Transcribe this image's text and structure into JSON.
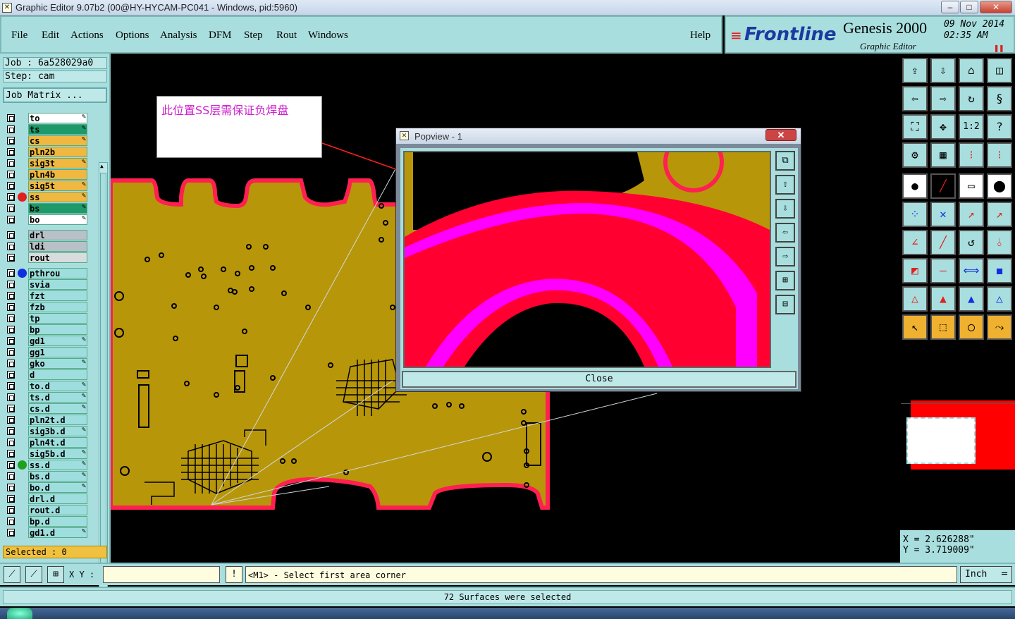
{
  "window": {
    "title": "Graphic Editor 9.07b2 (00@HY-HYCAM-PC041 - Windows, pid:5960)"
  },
  "menu": [
    "File",
    "Edit",
    "Actions",
    "Options",
    "Analysis",
    "DFM",
    "Step",
    "Rout",
    "Windows"
  ],
  "help": "Help",
  "logo": {
    "brand": "Frontline",
    "product": "Genesis 2000",
    "subtitle": "Graphic Editor",
    "date": "09 Nov 2014",
    "time": "02:35 AM"
  },
  "job": {
    "job": "Job : 6a528029a0",
    "step": "Step: cam",
    "matrix": "Job Matrix ..."
  },
  "layers": [
    {
      "name": "to",
      "color": "#ffffff",
      "edit": true
    },
    {
      "name": "ts",
      "color": "#1e9a6a",
      "edit": true
    },
    {
      "name": "cs",
      "color": "#f0b840",
      "edit": true
    },
    {
      "name": "pln2b",
      "color": "#f0b840",
      "edit": false
    },
    {
      "name": "sig3t",
      "color": "#f0b840",
      "edit": true
    },
    {
      "name": "pln4b",
      "color": "#f0b840",
      "edit": false
    },
    {
      "name": "sig5t",
      "color": "#f0b840",
      "edit": true
    },
    {
      "name": "ss",
      "color": "#f0b840",
      "edit": true,
      "dot": "#e02020"
    },
    {
      "name": "bs",
      "color": "#1e9a6a",
      "edit": true
    },
    {
      "name": "bo",
      "color": "#ffffff",
      "edit": true
    },
    {
      "name": "drl",
      "color": "#b8c0c8",
      "edit": false
    },
    {
      "name": "ldi",
      "color": "#b8c0c8",
      "edit": false
    },
    {
      "name": "rout",
      "color": "#d8dcdc",
      "edit": false
    },
    {
      "name": "pthrou",
      "color": "#9fdede",
      "edit": false,
      "dot": "#1030e0"
    },
    {
      "name": "svia",
      "color": "#9fdede",
      "edit": false
    },
    {
      "name": "fzt",
      "color": "#9fdede",
      "edit": false
    },
    {
      "name": "fzb",
      "color": "#9fdede",
      "edit": false
    },
    {
      "name": "tp",
      "color": "#9fdede",
      "edit": false
    },
    {
      "name": "bp",
      "color": "#9fdede",
      "edit": false
    },
    {
      "name": "gd1",
      "color": "#9fdede",
      "edit": true
    },
    {
      "name": "gg1",
      "color": "#9fdede",
      "edit": false
    },
    {
      "name": "gko",
      "color": "#9fdede",
      "edit": true
    },
    {
      "name": "d",
      "color": "#9fdede",
      "edit": false
    },
    {
      "name": "to.d",
      "color": "#9fdede",
      "edit": true
    },
    {
      "name": "ts.d",
      "color": "#9fdede",
      "edit": true
    },
    {
      "name": "cs.d",
      "color": "#9fdede",
      "edit": true
    },
    {
      "name": "pln2t.d",
      "color": "#9fdede",
      "edit": false
    },
    {
      "name": "sig3b.d",
      "color": "#9fdede",
      "edit": true
    },
    {
      "name": "pln4t.d",
      "color": "#9fdede",
      "edit": false
    },
    {
      "name": "sig5b.d",
      "color": "#9fdede",
      "edit": true
    },
    {
      "name": "ss.d",
      "color": "#9fdede",
      "edit": true,
      "dot": "#20a020"
    },
    {
      "name": "bs.d",
      "color": "#9fdede",
      "edit": true
    },
    {
      "name": "bo.d",
      "color": "#9fdede",
      "edit": true
    },
    {
      "name": "drl.d",
      "color": "#9fdede",
      "edit": false
    },
    {
      "name": "rout.d",
      "color": "#9fdede",
      "edit": false
    },
    {
      "name": "bp.d",
      "color": "#9fdede",
      "edit": false
    },
    {
      "name": "gd1.d",
      "color": "#9fdede",
      "edit": true
    }
  ],
  "selected": "Selected : 0",
  "annotation": "此位置SS层需保证负焊盘",
  "popview": {
    "title": "Popview - 1",
    "close": "Close"
  },
  "coords": {
    "x": "X = 2.626288\"",
    "y": "Y = 3.719009\""
  },
  "status": {
    "xy_label": "X Y :",
    "xy_value": "",
    "prompt": "<M1> - Select first area corner",
    "unit": "Inch"
  },
  "message": "72 Surfaces were selected",
  "colors": {
    "panel": "#a9dede",
    "board": "#b8960a",
    "outline": "#ff2050",
    "highlight": "#ff00ff"
  }
}
